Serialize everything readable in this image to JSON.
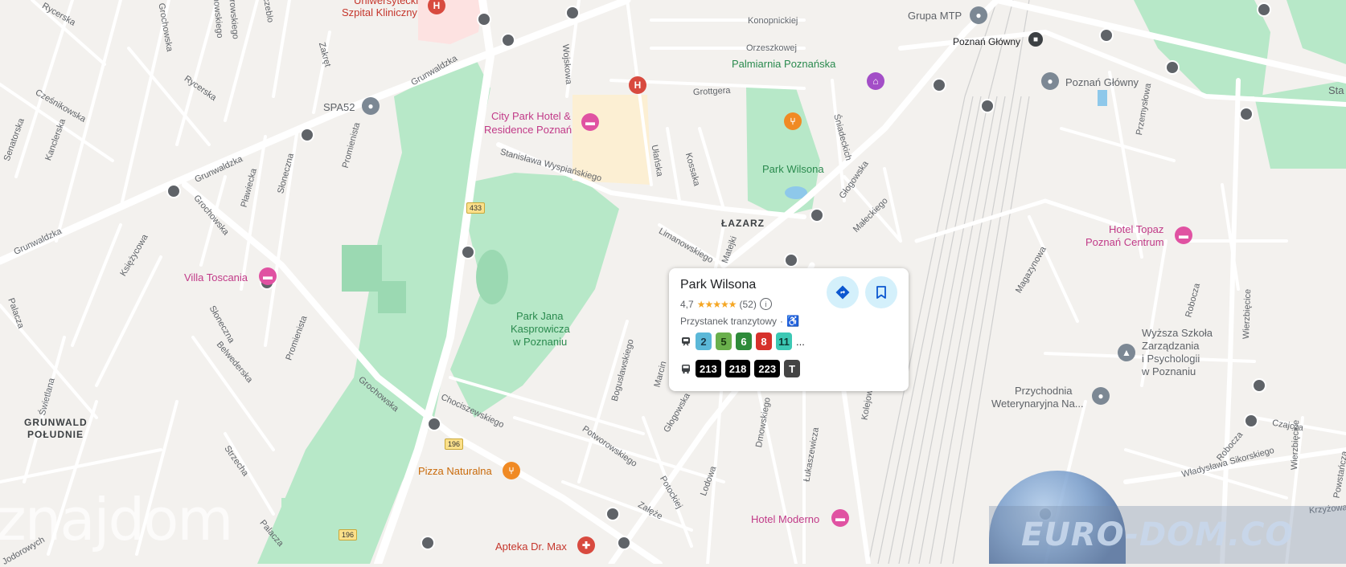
{
  "colors": {
    "land": "#f3f1ee",
    "park": "#b7e8c8",
    "road": "#ffffff",
    "hospital_area": "#fde2e1",
    "hotel_area": "#fcefd3",
    "rail": "#c4c4c4",
    "pink": "#c13a88",
    "green": "#2a8a4e"
  },
  "streets": {
    "rycerska1": "Rycerska",
    "grochowska_top": "Grochowska",
    "kochanowskiego": "Kochanowskiego",
    "dabrowskiego": "Dąbrowskiego",
    "zegrze": "Szczeblo",
    "zakret": "Zakręt",
    "grunwaldzka1": "Grunwaldzka",
    "grunwaldzka2": "Grunwaldzka",
    "grunwaldzka3": "Grunwaldzka",
    "czesnikowska": "Cześnikowska",
    "senatorska": "Senatorska",
    "kanclerska": "Kanclerska",
    "rycerska2": "Rycerska",
    "promienista1": "Promienista",
    "sloneczna1": "Słoneczna",
    "plowiecka": "Pławiecka",
    "grochowska_mid": "Grochowska",
    "ksiezycowa": "Księżycowa",
    "sloneczna2": "Słoneczna",
    "belwederska": "Belwederska",
    "swietlana": "Świetlana",
    "strzecha": "Strzecha",
    "promienista2": "Promienista",
    "grochowska_low": "Grochowska",
    "palacza1": "Palacza",
    "palacza2": "Palacza",
    "wojskowa": "Wojskowa",
    "stanislawa": "Stanisława Wyspiańskiego",
    "ulanska": "Ułańska",
    "grottgera": "Grottgera",
    "kossaka": "Kossaka",
    "limanowskiego": "Limanowskiego",
    "matejki": "Matejki",
    "konopnickiej": "Konopnickiej",
    "orzeszkowej": "Orzeszkowej",
    "sniadeckich": "Śniadeckich",
    "glogowska1": "Głogowska",
    "maleckiego": "Małeckiego",
    "glogowska2": "Głogowska",
    "chociszewskiego": "Chociszewskiego",
    "boguslawskiego": "Bogusławskiego",
    "marcinkowskiego": "Marcin",
    "potworowskiego": "Potworowskiego",
    "potockiej": "Potockiej",
    "lodowa": "Lodowa",
    "zaleze": "Załęże",
    "dmowskiego": "Dmowskiego",
    "lukaszewicza": "Łukaszewicza",
    "kolejowa": "Kolejowa",
    "magazynowa": "Magazynowa",
    "przemyslowa": "Przemysłowa",
    "robocza1": "Robocza",
    "wierzbiecice": "Wierzbięcice",
    "robocza2": "Robocza",
    "czajcza": "Czajcza",
    "sikorskiego": "Władysława Sikorskiego",
    "powstancza": "Powstańcza",
    "krzywowa": "Krzyżowa",
    "wierzbiecice2": "Wierzbięcice",
    "jodorowych": "Jodorowych"
  },
  "road_numbers": [
    "433",
    "196",
    "196"
  ],
  "districts": {
    "lazarz": "ŁAZARZ",
    "grunwald1": "GRUNWALD",
    "grunwald2": "POŁUDNIE"
  },
  "pois": {
    "hospital1": "Uniwersytecki",
    "hospital2": "Szpital Kliniczny",
    "spa": "SPA52",
    "cityparkhotel1": "City Park Hotel &",
    "cityparkhotel2": "Residence Poznań",
    "palmiarnia": "Palmiarnia Poznańska",
    "parkwilsona": "Park Wilsona",
    "grupamtp": "Grupa MTP",
    "poznanglowny_stop": "Poznań Główny",
    "poznanglowny": "Poznań Główny",
    "stare": "Sta",
    "villatoscania": "Villa Toscania",
    "parkjana1": "Park Jana",
    "parkjana2": "Kasprowicza",
    "parkjana3": "w Poznaniu",
    "hoteltopaz1": "Hotel Topaz",
    "hoteltopaz2": "Poznań Centrum",
    "wyzsza1": "Wyższa Szkoła",
    "wyzsza2": "Zarządzania",
    "wyzsza3": "i Psychologii",
    "wyzsza4": "w Poznaniu",
    "przychodnia1": "Przychodnia",
    "przychodnia2": "Weterynaryjna Na...",
    "pizza": "Pizza Naturalna",
    "hotelmoderno": "Hotel Moderno",
    "apteka": "Apteka Dr. Max"
  },
  "card": {
    "title": "Park Wilsona",
    "rating": "4,7",
    "stars": "★★★★★",
    "reviews": "(52)",
    "type": "Przystanek tranzytowy",
    "dot": "·",
    "tram_lines": [
      {
        "label": "2",
        "bg": "#5bb8d8",
        "fg": "#1a3a4a"
      },
      {
        "label": "5",
        "bg": "#6ab04c",
        "fg": "#1a3a10"
      },
      {
        "label": "6",
        "bg": "#2e8b3a",
        "fg": "#ffffff"
      },
      {
        "label": "8",
        "bg": "#d6312b",
        "fg": "#ffffff"
      },
      {
        "label": "11",
        "bg": "#3cc8b4",
        "fg": "#0d3a35"
      }
    ],
    "more": "...",
    "bus_lines": [
      {
        "label": "213",
        "bg": "#000000",
        "fg": "#ffffff"
      },
      {
        "label": "218",
        "bg": "#000000",
        "fg": "#ffffff"
      },
      {
        "label": "223",
        "bg": "#000000",
        "fg": "#ffffff"
      },
      {
        "label": "T",
        "bg": "#444444",
        "fg": "#ffffff"
      }
    ],
    "directions_icon": "directions-icon",
    "save_icon": "bookmark-icon"
  },
  "watermarks": {
    "left": "znajdom",
    "right": "EURO-DOM.CO"
  }
}
